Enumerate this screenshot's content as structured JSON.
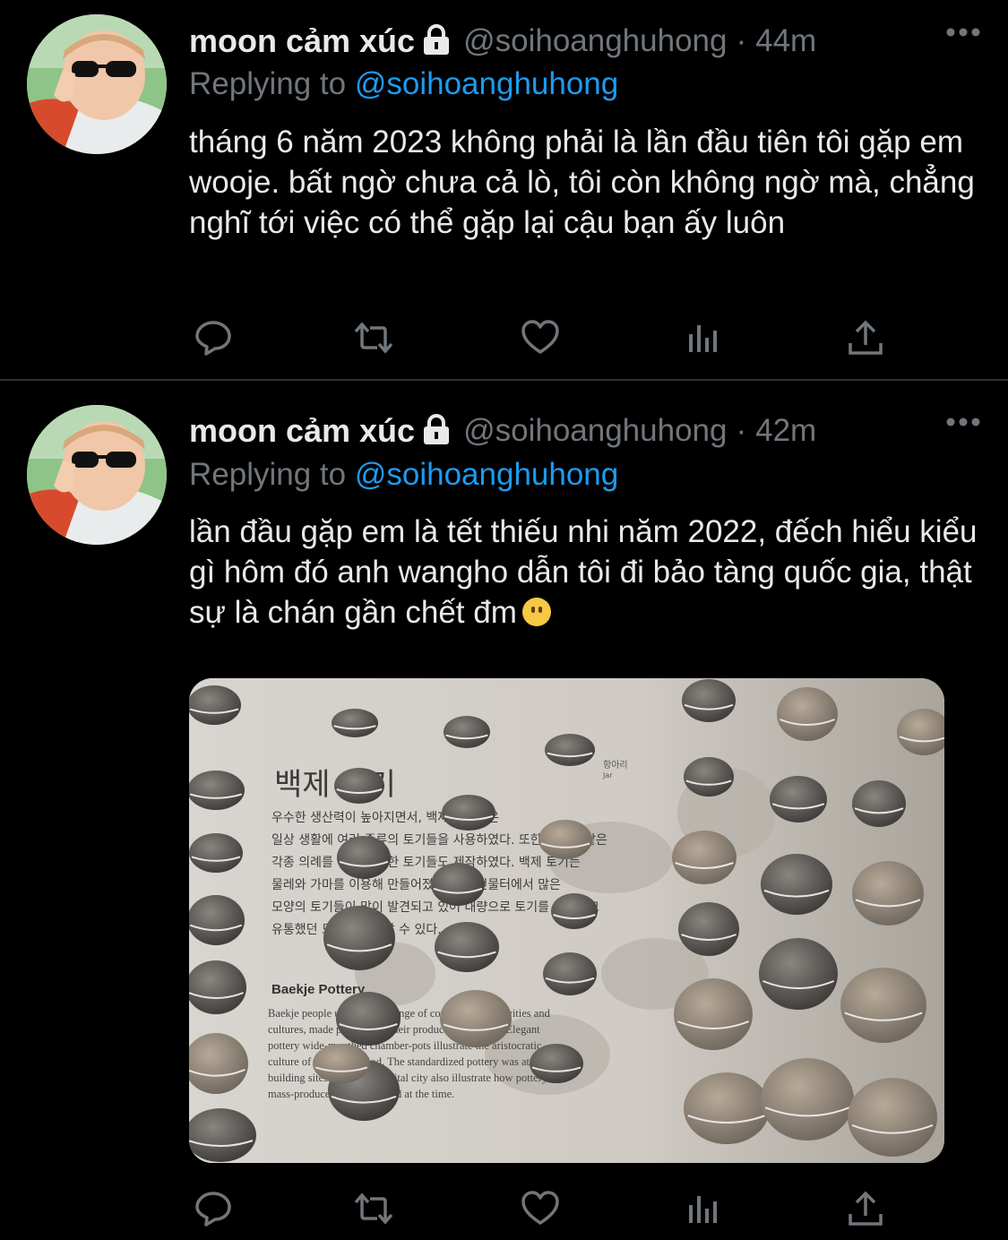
{
  "tweets": [
    {
      "name": "moon cảm xúc",
      "handle": "@soihoanghuhong",
      "time": "44m",
      "dot": "·",
      "reply_prefix": "Replying to",
      "reply_to": "@soihoanghuhong",
      "text": "tháng 6 năm 2023 không phải là lần đầu tiên tôi gặp em wooje. bất ngờ chưa cả lò, tôi còn không ngờ mà, chẳng nghĩ tới việc có thể gặp lại cậu bạn ấy luôn",
      "has_media": false
    },
    {
      "name": "moon cảm xúc",
      "handle": "@soihoanghuhong",
      "time": "42m",
      "dot": "·",
      "reply_prefix": "Replying to",
      "reply_to": "@soihoanghuhong",
      "text": "lần đầu gặp em là tết thiếu nhi năm 2022, đếch hiểu kiểu gì hôm đó anh wangho dẫn tôi đi bảo tàng quốc gia, thật sự là chán gần chết đm",
      "emoji": "slightly-smiling-face",
      "has_media": true
    }
  ],
  "media": {
    "title_ko": "백제 토기",
    "title_en": "Baekje Pottery",
    "label_ko": "항아리",
    "label_en": "Jar",
    "ko_lines": [
      "우수한 생산력이 높아지면서, 백제 사람들은",
      "일상 생활에 여러 종류의 토기들을 사용하였다. 또한 제사와 같은",
      "각종 의례를 위한 특수한 토기들도 제작하였다. 백제 토기는",
      "물레와 가마를 이용해 만들어졌으며 내 건물터에서 많은",
      "모양의 토기들이 많이 발견되고 있어 대량으로 토기를 생산하고",
      "유통했던 모습을 추측할 수 있다."
    ],
    "en_lines": [
      "Baekje people used a wide range of consumption activities and",
      "cultures, made possible by their productive capacity. Elegant",
      "pottery wide-mouthed chamber-pots illustrate the aristocratic",
      "culture of the Sabi period. The standardized pottery was at the",
      "building sites within the capital city also illustrate how pottery was",
      "mass-produced and circulated at the time."
    ]
  },
  "icons": [
    "reply-icon",
    "retweet-icon",
    "like-icon",
    "analytics-icon",
    "share-icon",
    "lock-icon",
    "more-icon"
  ],
  "colors": {
    "background": "#000000",
    "text": "#e7e9ea",
    "muted": "#71767b",
    "link": "#1d9bf0",
    "divider": "#2f3336"
  }
}
